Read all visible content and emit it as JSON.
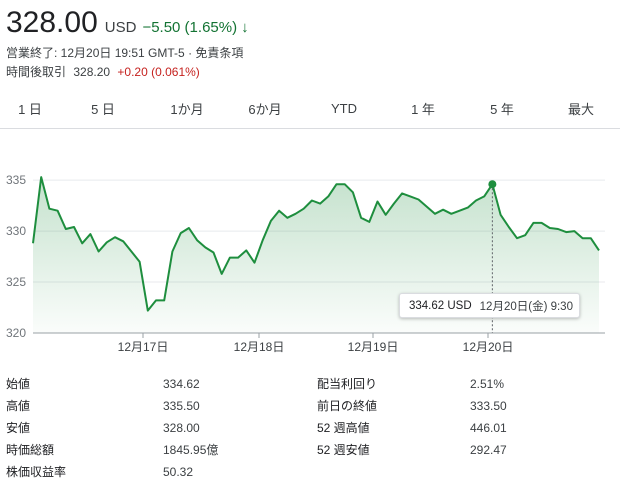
{
  "header": {
    "price": "328.00",
    "currency": "USD",
    "change": "−5.50 (1.65%)",
    "change_arrow": "↓",
    "status_line": "営業終了: 12月20日 19:51 GMT-5 · 免責条項",
    "after_hours_label": "時間後取引",
    "after_hours_price": "328.20",
    "after_hours_change": "+0.20 (0.061%)"
  },
  "colors": {
    "line": "#1e8e3e",
    "up": "#137333",
    "down": "#c5221f"
  },
  "tabs": [
    {
      "label": "1 日",
      "active": false
    },
    {
      "label": "5 日",
      "active": true
    },
    {
      "label": "1か月",
      "active": false
    },
    {
      "label": "6か月",
      "active": false
    },
    {
      "label": "YTD",
      "active": false
    },
    {
      "label": "1 年",
      "active": false
    },
    {
      "label": "5 年",
      "active": false
    },
    {
      "label": "最大",
      "active": false
    }
  ],
  "chart_data": {
    "type": "area",
    "y_ticks": [
      "335",
      "330",
      "325",
      "320"
    ],
    "x_ticks": [
      "12月17日",
      "12月18日",
      "12月19日",
      "12月20日"
    ],
    "ylim": [
      320,
      335.6
    ],
    "grid": true,
    "series": [
      {
        "values": [
          328.8,
          335.3,
          332.2,
          332.0,
          330.2,
          330.4,
          328.8,
          329.7,
          328.0,
          328.9,
          329.4,
          329.0,
          328.0,
          327.0,
          322.2,
          323.2,
          323.2,
          328.0,
          329.8,
          330.3,
          329.1,
          328.4,
          327.9,
          325.8,
          327.4,
          327.4,
          328.1,
          326.9,
          329.1,
          331.0,
          332.0,
          331.3,
          331.7,
          332.2,
          333.0,
          332.7,
          333.4,
          334.6,
          334.6,
          333.8,
          331.3,
          330.9,
          332.9,
          331.6,
          332.7,
          333.7,
          333.4,
          333.1,
          332.4,
          331.7,
          332.1,
          331.7,
          332.0,
          332.3,
          333.0,
          333.4,
          334.6,
          331.6,
          330.4,
          329.3,
          329.6,
          330.8,
          330.8,
          330.3,
          330.2,
          329.9,
          330.0,
          329.3,
          329.3,
          328.1
        ]
      }
    ]
  },
  "tooltip": {
    "price": "334.62 USD",
    "date": "12月20日(金) 9:30"
  },
  "stats": {
    "rows": [
      {
        "l_label": "始値",
        "l_value": "334.62",
        "r_label": "配当利回り",
        "r_value": "2.51%"
      },
      {
        "l_label": "高値",
        "l_value": "335.50",
        "r_label": "前日の終値",
        "r_value": "333.50"
      },
      {
        "l_label": "安値",
        "l_value": "328.00",
        "r_label": "52 週高値",
        "r_value": "446.01"
      },
      {
        "l_label": "時価総額",
        "l_value": "1845.95億",
        "r_label": "52 週安値",
        "r_value": "292.47"
      },
      {
        "l_label": "株価収益率",
        "l_value": "50.32",
        "r_label": "",
        "r_value": ""
      }
    ]
  }
}
